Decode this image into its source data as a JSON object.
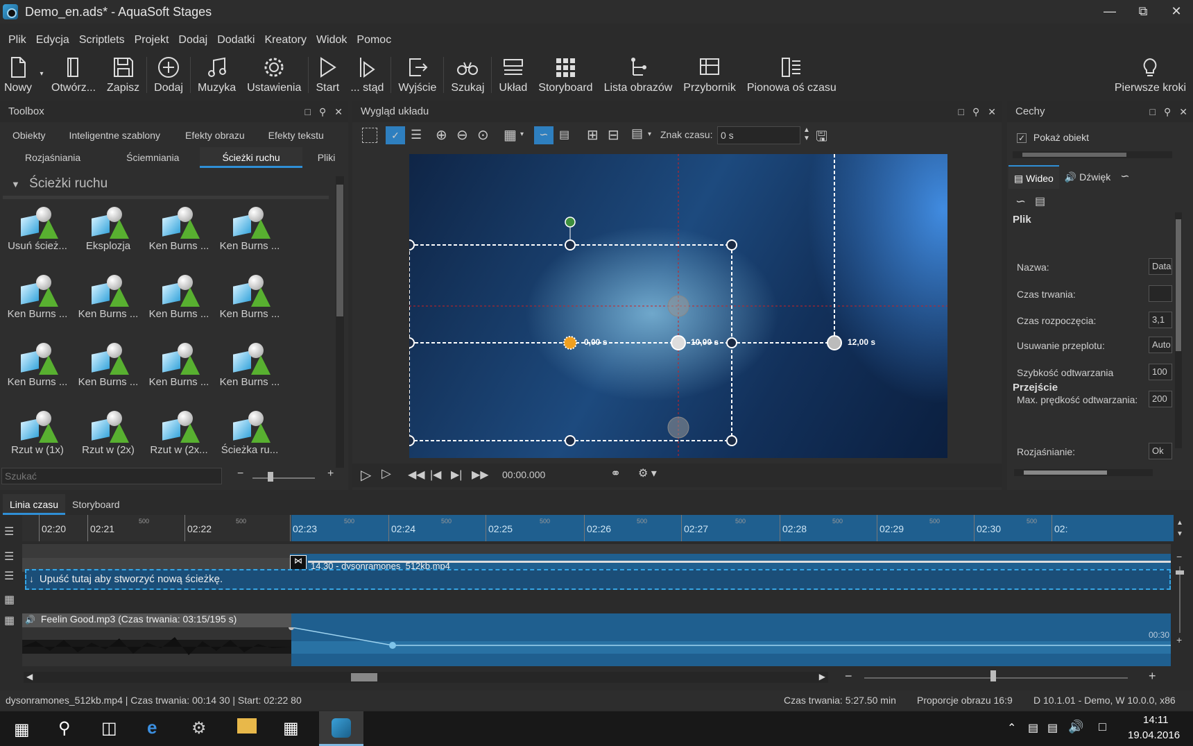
{
  "window": {
    "title": "Demo_en.ads* - AquaSoft Stages"
  },
  "menu": [
    "Plik",
    "Edycja",
    "Scriptlets",
    "Projekt",
    "Dodaj",
    "Dodatki",
    "Kreatory",
    "Widok",
    "Pomoc"
  ],
  "toolbar": {
    "nowy": "Nowy",
    "otworz": "Otwórz...",
    "zapisz": "Zapisz",
    "dodaj": "Dodaj",
    "muzyka": "Muzyka",
    "ustawienia": "Ustawienia",
    "start": "Start",
    "stad": "... stąd",
    "wyjscie": "Wyjście",
    "szukaj": "Szukaj",
    "uklad": "Układ",
    "storyboard": "Storyboard",
    "lista": "Lista obrazów",
    "przybornik": "Przybornik",
    "pionowa": "Pionowa oś czasu",
    "pierwsze": "Pierwsze kroki"
  },
  "toolbox": {
    "title": "Toolbox",
    "tabs_row1": [
      "Obiekty",
      "Inteligentne szablony",
      "Efekty obrazu",
      "Efekty tekstu"
    ],
    "tabs_row2": [
      "Rozjaśniania",
      "Ściemniania",
      "Ścieżki ruchu",
      "Pliki"
    ],
    "section": "Ścieżki ruchu",
    "items": [
      "Usuń ścież...",
      "Eksplozja",
      "Ken Burns ...",
      "Ken Burns ...",
      "Ken Burns ...",
      "Ken Burns ...",
      "Ken Burns ...",
      "Ken Burns ...",
      "Ken Burns ...",
      "Ken Burns ...",
      "Ken Burns ...",
      "Ken Burns ...",
      "Rzut w (1x)",
      "Rzut w (2x)",
      "Rzut w (2x...",
      "Ścieżka ru..."
    ],
    "search_placeholder": "Szukać"
  },
  "preview": {
    "title": "Wygląd układu",
    "time_label": "Znak czasu:",
    "time_value": "0 s",
    "markers": [
      "0,00 s",
      "10,00 s",
      "12,00 s"
    ],
    "timecode": "00:00.000"
  },
  "props": {
    "title": "Cechy",
    "show_object": "Pokaż obiekt",
    "tab_video": "Wideo",
    "tab_sound": "Dźwięk",
    "section_file": "Plik",
    "rows": [
      {
        "label": "Nazwa:",
        "value": "Data"
      },
      {
        "label": "Czas trwania:",
        "value": ""
      },
      {
        "label": "Czas rozpoczęcia:",
        "value": "3,1"
      },
      {
        "label": "Usuwanie przeplotu:",
        "value": "Auto"
      },
      {
        "label": "Szybkość odtwarzania",
        "value": "100"
      },
      {
        "label": "Max. prędkość odtwarzania:",
        "value": "200"
      }
    ],
    "section_transition": "Przejście",
    "fade_label": "Rozjaśnianie:",
    "fade_value": "Ok"
  },
  "timeline": {
    "tabs": [
      "Linia czasu",
      "Storyboard"
    ],
    "ruler": [
      "02:20",
      "02:21",
      "02:22",
      "02:23",
      "02:24",
      "02:25",
      "02:26",
      "02:27",
      "02:28",
      "02:29",
      "02:30",
      "02:"
    ],
    "ruler_minor": "500",
    "clip_label": "14,30 - dysonramones_512kb.mp4",
    "drop_text": "Upuść tutaj aby stworzyć nową ścieżkę.",
    "audio_label": "Feelin Good.mp3 (Czas trwania: 03:15/195 s)",
    "audio_end": "00:30"
  },
  "status": {
    "left": "dysonramones_512kb.mp4 | Czas trwania: 00:14 30 | Start: 02:22 80",
    "duration": "Czas trwania: 5:27.50 min",
    "ratio": "Proporcje obrazu 16:9",
    "version": "D 10.1.01 - Demo, W 10.0.0, x86"
  },
  "taskbar": {
    "time": "14:11",
    "date": "19.04.2016"
  }
}
